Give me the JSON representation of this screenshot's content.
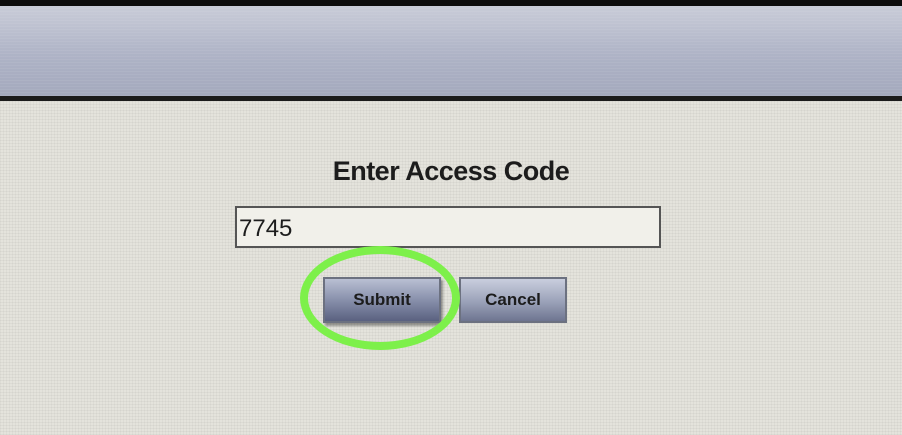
{
  "dialog": {
    "title": "Enter Access Code"
  },
  "access_code_field": {
    "value": "7745"
  },
  "buttons": {
    "submit_label": "Submit",
    "cancel_label": "Cancel"
  },
  "colors": {
    "title_bar": "#aeb3c6",
    "screen_background": "#e4e3dc",
    "highlight_ring": "#7df04a"
  }
}
